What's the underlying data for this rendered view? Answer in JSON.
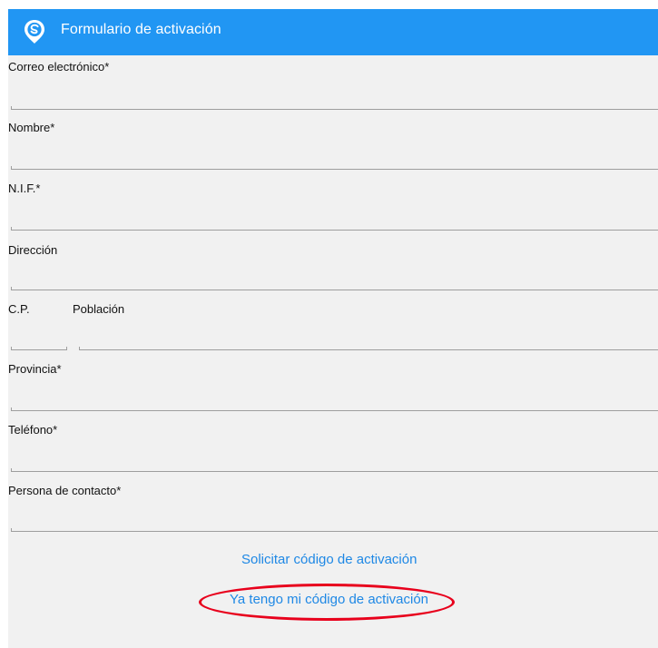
{
  "appbar": {
    "title": "Formulario de activación",
    "logo_icon": "location-pin-s-icon",
    "color": "#2196f3"
  },
  "form": {
    "email_label": "Correo electrónico*",
    "name_label": "Nombre*",
    "nif_label": "N.I.F.*",
    "address_label": "Dirección",
    "postal_code_label": "C.P.",
    "city_label": "Población",
    "province_label": "Provincia*",
    "phone_label": "Teléfono*",
    "contact_label": "Persona de contacto*"
  },
  "actions": {
    "request_code": "Solicitar código de activación",
    "have_code": "Ya tengo mi código de activación",
    "link_color": "#1e88e5",
    "highlight_color": "#e8001c"
  }
}
